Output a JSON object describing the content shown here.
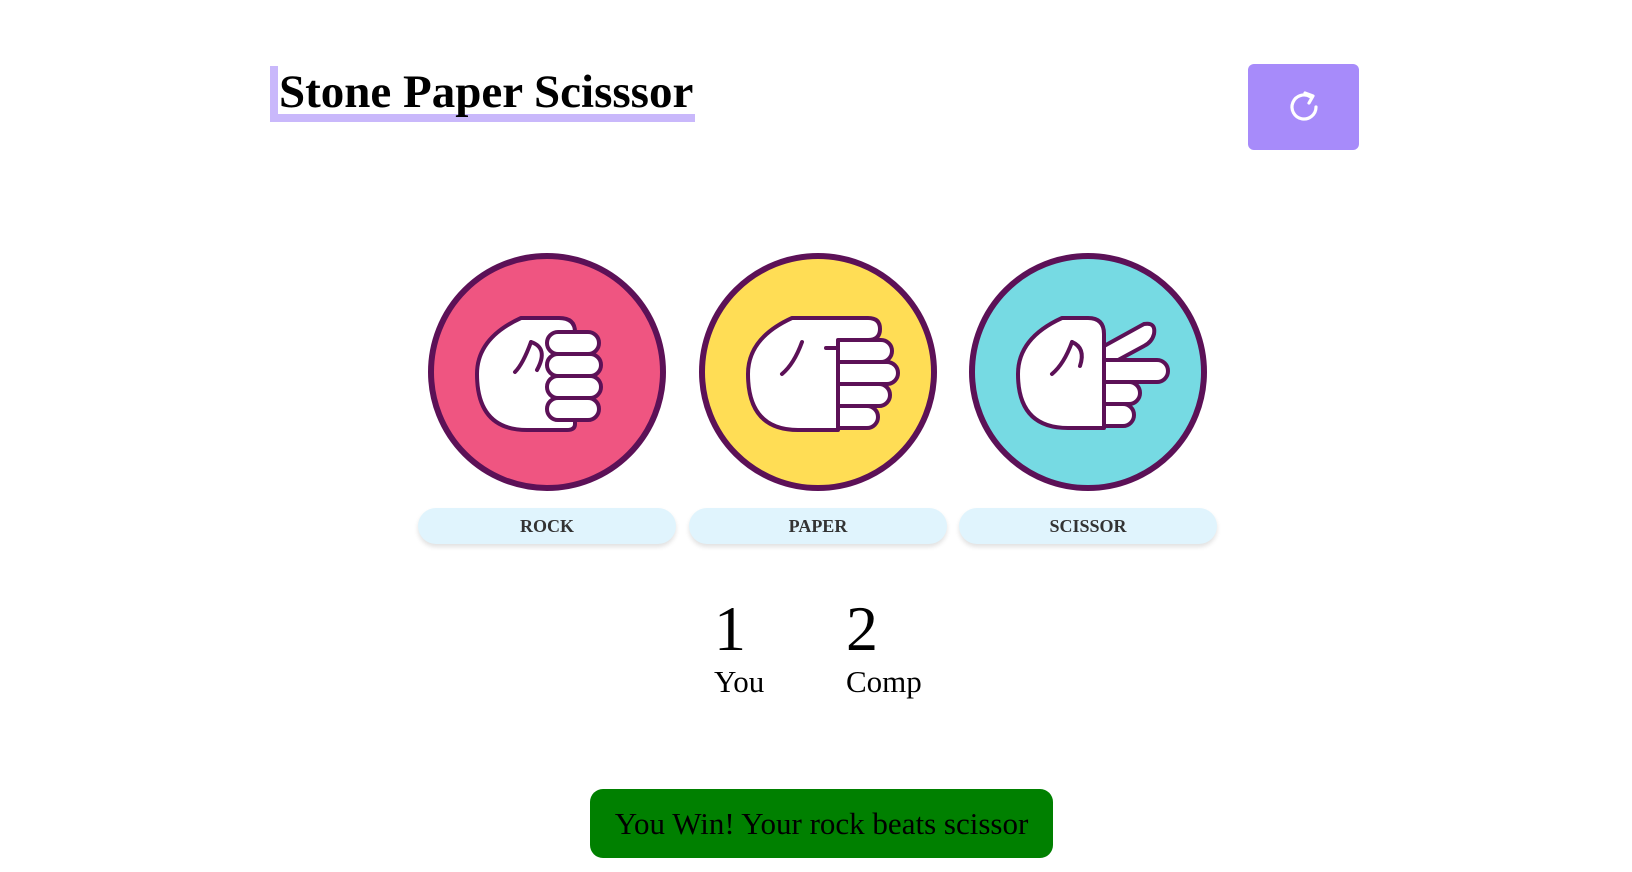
{
  "header": {
    "title": "Stone Paper Scisssor",
    "reset_icon": "refresh-icon"
  },
  "choices": [
    {
      "label": "ROCK",
      "icon": "rock-hand-icon",
      "color": "#ef5581"
    },
    {
      "label": "PAPER",
      "icon": "paper-hand-icon",
      "color": "#ffdd55"
    },
    {
      "label": "SCISSOR",
      "icon": "scissor-hand-icon",
      "color": "#76dae3"
    }
  ],
  "scores": {
    "user": {
      "value": "1",
      "label": "You"
    },
    "computer": {
      "value": "2",
      "label": "Comp"
    }
  },
  "message": {
    "text": "You Win! Your rock beats scissor",
    "color": "#008000"
  },
  "colors": {
    "accent": "#a78bfa",
    "outline": "#5c1157"
  }
}
